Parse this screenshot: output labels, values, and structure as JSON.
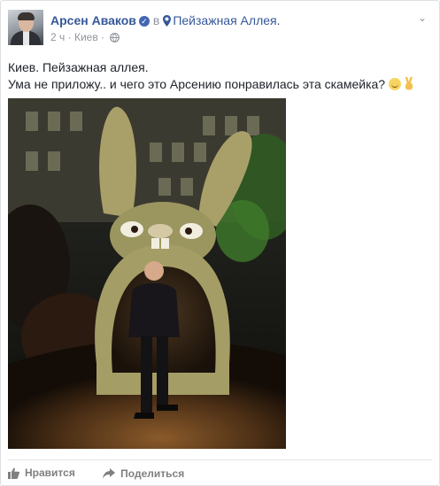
{
  "post": {
    "author": "Арсен Аваков",
    "in_word": "в",
    "place": "Пейзажная Аллея.",
    "time": "2 ч",
    "separator": "·",
    "location": "Киев",
    "text_line1": "Киев. Пейзажная аллея.",
    "text_line2": "Ума не приложу.. и чего это Арсению понравилась эта скамейка?"
  },
  "actions": {
    "like_label": "Нравится",
    "share_label": "Поделиться"
  },
  "colors": {
    "link": "#365899",
    "verified": "#4267b2",
    "muted": "#90949c"
  },
  "icons": [
    "verified-icon",
    "location-pin-icon",
    "globe-icon",
    "chevron-down-icon",
    "smiley-icon",
    "victory-hand-icon",
    "like-icon",
    "share-icon"
  ]
}
